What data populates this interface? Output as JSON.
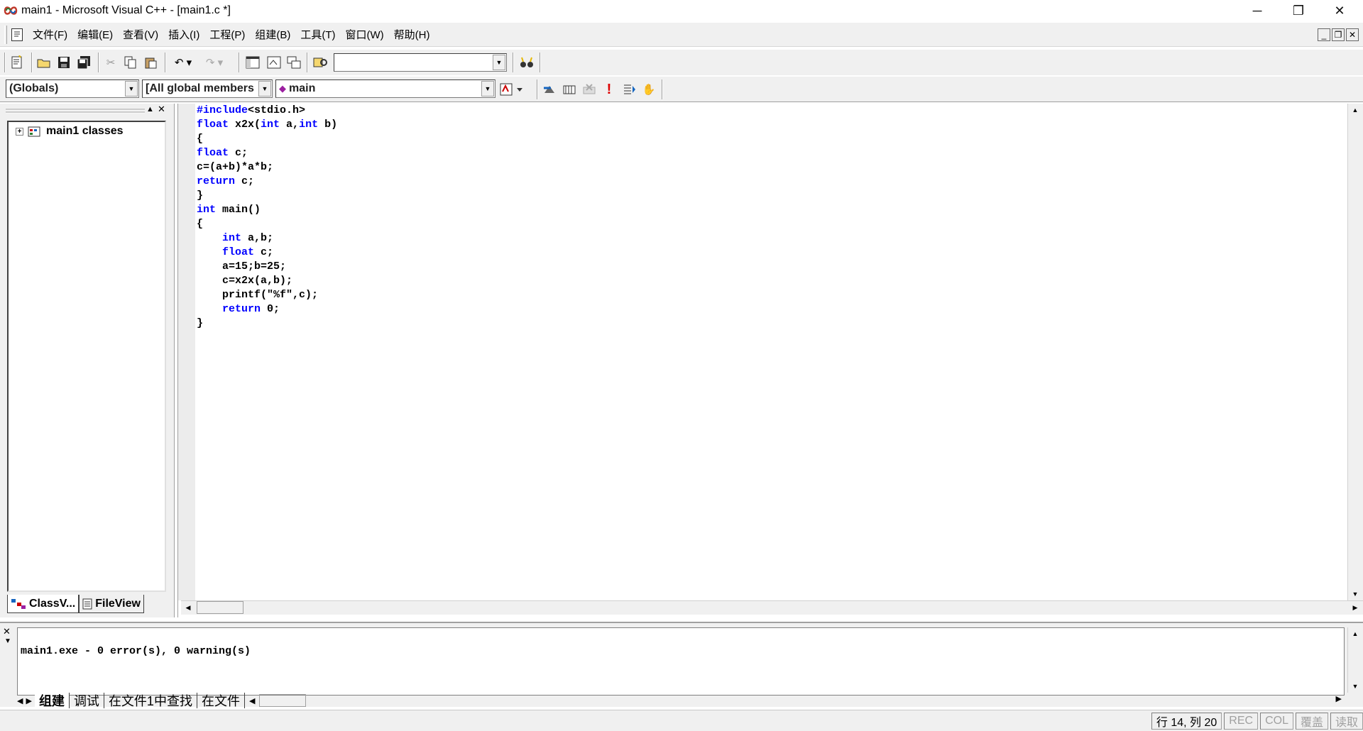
{
  "window": {
    "title": "main1 - Microsoft Visual C++ - [main1.c *]",
    "minimize": "─",
    "restore": "❐",
    "close": "✕"
  },
  "menu": [
    "文件(F)",
    "编辑(E)",
    "查看(V)",
    "插入(I)",
    "工程(P)",
    "组建(B)",
    "工具(T)",
    "窗口(W)",
    "帮助(H)"
  ],
  "mdi": {
    "minimize": "_",
    "restore": "❐",
    "close": "✕"
  },
  "toolbar": {
    "find_value": ""
  },
  "wizardbar": {
    "class_combo": "(Globals)",
    "filter_combo": "[All global members",
    "member_combo": "main"
  },
  "workspace": {
    "tree_root": "main1 classes",
    "tab_classview": "ClassV...",
    "tab_fileview": "FileView"
  },
  "editor": {
    "lines": [
      [
        {
          "t": "#include",
          "k": true
        },
        {
          "t": "<stdio.h>"
        }
      ],
      [
        {
          "t": "float",
          "k": true
        },
        {
          "t": " x2x("
        },
        {
          "t": "int",
          "k": true
        },
        {
          "t": " a,"
        },
        {
          "t": "int",
          "k": true
        },
        {
          "t": " b)"
        }
      ],
      [
        {
          "t": "{"
        }
      ],
      [
        {
          "t": "float",
          "k": true
        },
        {
          "t": " c;"
        }
      ],
      [
        {
          "t": "c=(a+b)*a*b;"
        }
      ],
      [
        {
          "t": "return",
          "k": true
        },
        {
          "t": " c;"
        }
      ],
      [
        {
          "t": "}"
        }
      ],
      [
        {
          "t": "int",
          "k": true
        },
        {
          "t": " main()"
        }
      ],
      [
        {
          "t": "{"
        }
      ],
      [
        {
          "t": "    "
        },
        {
          "t": "int",
          "k": true
        },
        {
          "t": " a,b;"
        }
      ],
      [
        {
          "t": "    "
        },
        {
          "t": "float",
          "k": true
        },
        {
          "t": " c;"
        }
      ],
      [
        {
          "t": "    a=15;b=25;"
        }
      ],
      [
        {
          "t": "    c=x2x(a,b);"
        }
      ],
      [
        {
          "t": "    printf(\"%f\",c);"
        }
      ],
      [
        {
          "t": "    "
        },
        {
          "t": "return",
          "k": true
        },
        {
          "t": " 0;"
        }
      ],
      [
        {
          "t": "}"
        }
      ]
    ],
    "keyword_color": "#0000ff"
  },
  "output": {
    "text": "main1.exe - 0 error(s), 0 warning(s)",
    "tabs": [
      "组建",
      "调试",
      "在文件1中查找",
      "在文件"
    ]
  },
  "status": {
    "position": "行 14, 列 20",
    "rec": "REC",
    "col": "COL",
    "ovr": "覆盖",
    "read": "读取"
  }
}
